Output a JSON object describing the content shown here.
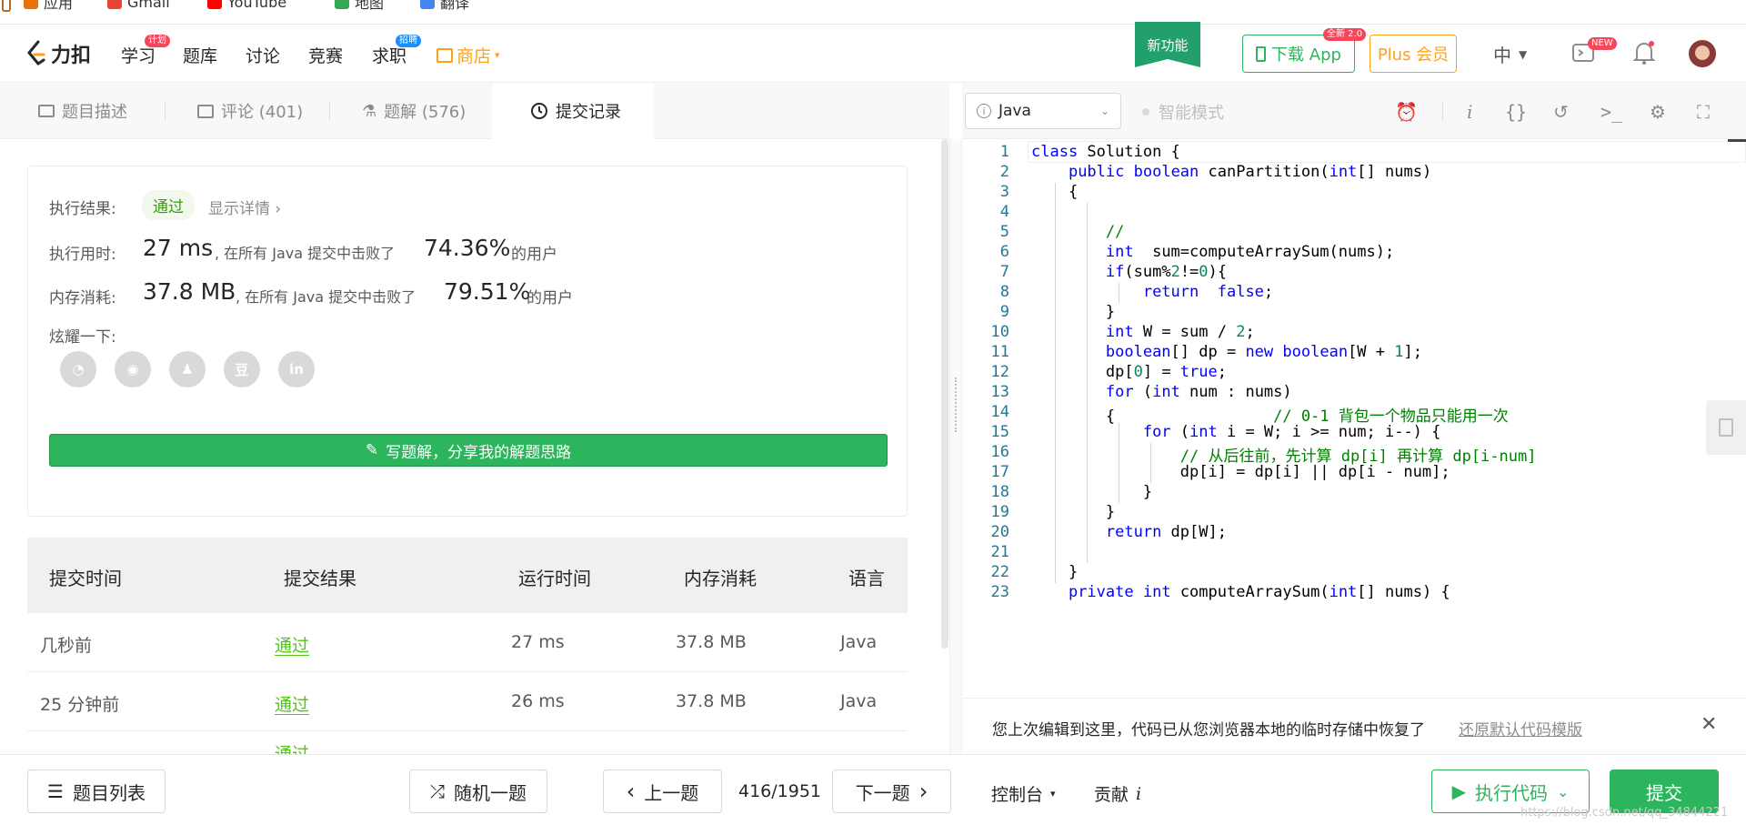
{
  "bookmarks": [
    {
      "label": "应用",
      "icon": "apps-grid-icon",
      "color": "#e8710a"
    },
    {
      "label": "Gmail",
      "icon": "gmail-icon",
      "color": "#ea4335"
    },
    {
      "label": "YouTube",
      "icon": "youtube-icon",
      "color": "#ff0000"
    },
    {
      "label": "地图",
      "icon": "maps-icon",
      "color": "#34a853"
    },
    {
      "label": "翻译",
      "icon": "translate-icon",
      "color": "#4285f4"
    }
  ],
  "nav": {
    "logo_text": "力扣",
    "links": [
      {
        "label": "学习",
        "badge": "计划",
        "badge_color": "#f5475b"
      },
      {
        "label": "题库",
        "badge": ""
      },
      {
        "label": "讨论",
        "badge": ""
      },
      {
        "label": "竞赛",
        "badge": ""
      },
      {
        "label": "求职",
        "badge": "招聘",
        "badge_color": "#1890ff"
      },
      {
        "label": "商店",
        "badge": ""
      }
    ],
    "new_feature": "新功能",
    "download_label": "下载 App",
    "download_badge": "全新 2.0",
    "plus_label": "Plus 会员",
    "lang": "中",
    "new_badge": "NEW",
    "accent": "#ffa116",
    "green": "#2db55d"
  },
  "left_tabs": [
    {
      "label": "题目描述",
      "icon": "description-icon"
    },
    {
      "label": "评论 (401)",
      "icon": "comment-icon"
    },
    {
      "label": "题解 (576)",
      "icon": "flask-icon"
    },
    {
      "label": "提交记录",
      "icon": "clock-icon"
    }
  ],
  "result": {
    "status_label": "执行结果:",
    "status": "通过",
    "details_link": "显示详情 ›",
    "time_label": "执行用时:",
    "time_value": "27 ms",
    "time_text": ", 在所有 Java 提交中击败了",
    "time_pct": "74.36%",
    "users": "的用户",
    "mem_label": "内存消耗:",
    "mem_value": "37.8 MB",
    "mem_text": ", 在所有 Java 提交中击败了",
    "mem_pct": "79.51%",
    "share_label": "炫耀一下:",
    "share_icons": [
      "wechat-icon",
      "weibo-icon",
      "qq-icon",
      "douban-icon",
      "linkedin-icon"
    ],
    "write_button": "写题解，分享我的解题思路"
  },
  "table": {
    "headers": [
      "提交时间",
      "提交结果",
      "运行时间",
      "内存消耗",
      "语言"
    ],
    "rows": [
      {
        "time": "几秒前",
        "result": "通过",
        "runtime": "27 ms",
        "memory": "37.8 MB",
        "lang": "Java"
      },
      {
        "time": "25 分钟前",
        "result": "通过",
        "runtime": "26 ms",
        "memory": "37.8 MB",
        "lang": "Java"
      },
      {
        "time": "",
        "result": "通过",
        "runtime": "",
        "memory": "",
        "lang": ""
      }
    ]
  },
  "editor": {
    "language": "Java",
    "smart_mode": "智能模式",
    "lines": [
      "class Solution {",
      "    public boolean canPartition(int[] nums)",
      "    {",
      "",
      "        //",
      "        int  sum=computeArraySum(nums);",
      "        if(sum%2!=0){",
      "            return  false;",
      "        }",
      "        int W = sum / 2;",
      "        boolean[] dp = new boolean[W + 1];",
      "        dp[0] = true;",
      "        for (int num : nums)",
      "        {                 // 0-1 背包一个物品只能用一次",
      "            for (int i = W; i >= num; i--) {",
      "                // 从后往前，先计算 dp[i] 再计算 dp[i-num]",
      "                dp[i] = dp[i] || dp[i - num];",
      "            }",
      "        }",
      "        return dp[W];",
      "",
      "    }",
      "    private int computeArraySum(int[] nums) {"
    ]
  },
  "notice": {
    "text": "您上次编辑到这里，代码已从您浏览器本地的临时存储中恢复了",
    "link": "还原默认代码模版"
  },
  "bottom": {
    "problem_list": "题目列表",
    "random": "随机一题",
    "prev": "上一题",
    "counter": "416/1951",
    "next": "下一题",
    "console": "控制台",
    "contribute": "贡献",
    "run": "执行代码",
    "submit": "提交",
    "watermark": "https://blog.csdn.net/qq_34844221"
  }
}
